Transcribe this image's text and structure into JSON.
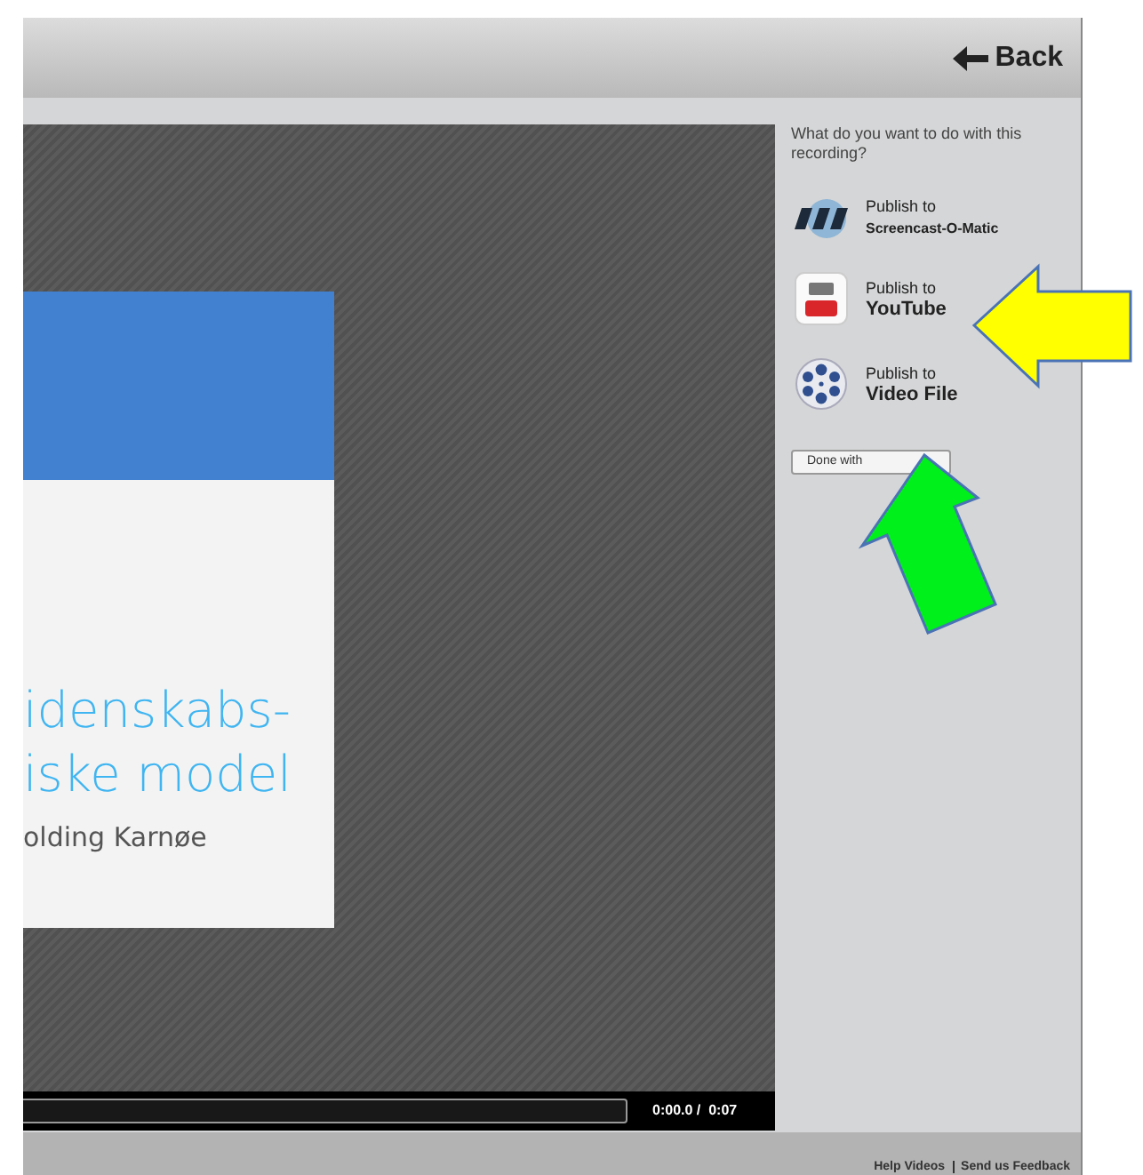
{
  "header": {
    "back_label": "Back"
  },
  "slide": {
    "title_lines": [
      "idenskabs-",
      "iske model"
    ],
    "author": "olding Karnøe"
  },
  "player": {
    "time": "0:00.0 /  0:07"
  },
  "panel": {
    "prompt": "What do you want to do with this recording?",
    "options": [
      {
        "kind": "som",
        "line1": "Publish to",
        "line2": "Screencast-O-Matic"
      },
      {
        "kind": "youtube",
        "line1": "Publish to",
        "line2": "YouTube"
      },
      {
        "kind": "file",
        "line1": "Publish to",
        "line2": "Video File"
      }
    ],
    "done_label": "Done with"
  },
  "footer": {
    "links": [
      "Help Videos",
      "Send us Feedback"
    ]
  }
}
